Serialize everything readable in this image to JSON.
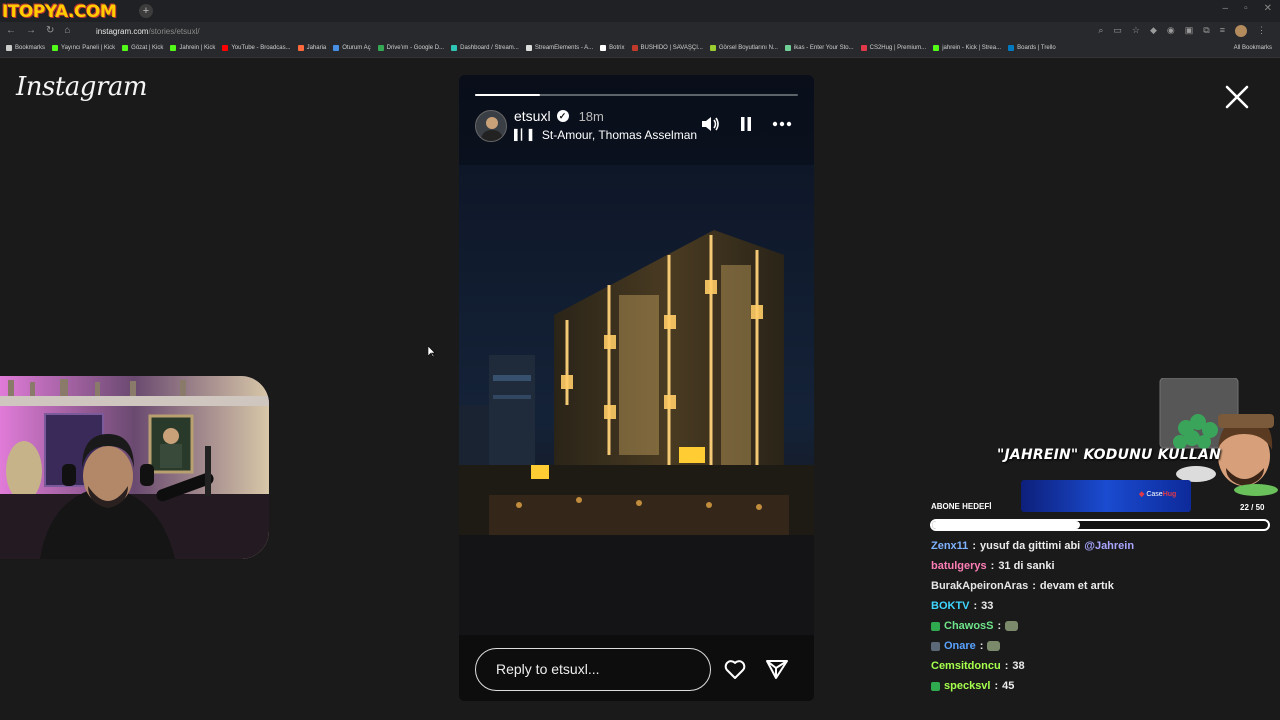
{
  "browser": {
    "tab_logo": "ITOPYA.COM",
    "new_tab_symbol": "+",
    "window_controls": [
      "–",
      "▫",
      "✕"
    ],
    "url_host": "instagram.com",
    "url_path": "/stories/etsuxl/",
    "bookmarks": [
      {
        "label": "Bookmarks",
        "color": "#cccccc"
      },
      {
        "label": "Yayıncı Paneli | Kick",
        "color": "#53fc18"
      },
      {
        "label": "Gözat | Kick",
        "color": "#53fc18"
      },
      {
        "label": "Jahrein | Kick",
        "color": "#53fc18"
      },
      {
        "label": "YouTube - Broadcas...",
        "color": "#ff0000"
      },
      {
        "label": "Jaharia",
        "color": "#ff6a3d"
      },
      {
        "label": "Oturum Aç",
        "color": "#4a90e2"
      },
      {
        "label": "Drive'ım - Google D...",
        "color": "#34a853"
      },
      {
        "label": "Dashboard / Stream...",
        "color": "#2ec4b6"
      },
      {
        "label": "StreamElements - A...",
        "color": "#dddddd"
      },
      {
        "label": "Botrix",
        "color": "#ffffff"
      },
      {
        "label": "BUSHIDO | SAVAŞÇI...",
        "color": "#c0392b"
      },
      {
        "label": "Görsel Boyutlarını N...",
        "color": "#9acd32"
      },
      {
        "label": "ikas - Enter Your Sto...",
        "color": "#6fcf97"
      },
      {
        "label": "CS2Hug | Premium...",
        "color": "#e0394a"
      },
      {
        "label": "jahrein - Kick | Strea...",
        "color": "#53fc18"
      },
      {
        "label": "Boards | Trello",
        "color": "#0079bf"
      }
    ],
    "all_bookmarks": "All Bookmarks"
  },
  "instagram": {
    "logo": "Instagram",
    "story": {
      "username": "etsuxl",
      "verified_mark": "✓",
      "time_ago": "18m",
      "music": "St-Amour, Thomas Asselman",
      "progress_fraction": 0.2,
      "reply_placeholder": "Reply to etsuxl...",
      "controls": {
        "volume": "volume-icon",
        "pause": "pause-icon",
        "more": "more-icon"
      }
    }
  },
  "overlay": {
    "promo": "\"JAHREIN\" KODUNU KULLAN",
    "goal_label": "ABONE HEDEFİ",
    "sponsor": {
      "prefix": "Case",
      "suffix": "Hug"
    },
    "goal_count": "22 / 50",
    "goal_fraction": 0.44,
    "chat": [
      {
        "user": "Zenx11",
        "color": "#7fb2ff",
        "badge": "",
        "text": "yusuf da gittimi abi",
        "mention": "@Jahrein",
        "emote": false
      },
      {
        "user": "batulgerys",
        "color": "#ff7eb6",
        "badge": "",
        "text": "31 di sanki",
        "mention": "",
        "emote": false
      },
      {
        "user": "BurakApeironAras",
        "color": "#e6e6e6",
        "badge": "",
        "text": "devam et artık",
        "mention": "",
        "emote": false
      },
      {
        "user": "BOKTV",
        "color": "#3fd6ff",
        "badge": "",
        "text": "33",
        "mention": "",
        "emote": false
      },
      {
        "user": "ChawosS",
        "color": "#6fe38a",
        "badge": "#2faa4f",
        "text": "",
        "mention": "",
        "emote": true
      },
      {
        "user": "Onare",
        "color": "#5aa2ff",
        "badge": "#5a6878",
        "text": "",
        "mention": "",
        "emote": true
      },
      {
        "user": "Cemsitdoncu",
        "color": "#a6ff4d",
        "badge": "",
        "text": "38",
        "mention": "",
        "emote": false
      },
      {
        "user": "specksvl",
        "color": "#a6ff4d",
        "badge": "#2faa4f",
        "text": "45",
        "mention": "",
        "emote": false
      }
    ]
  }
}
